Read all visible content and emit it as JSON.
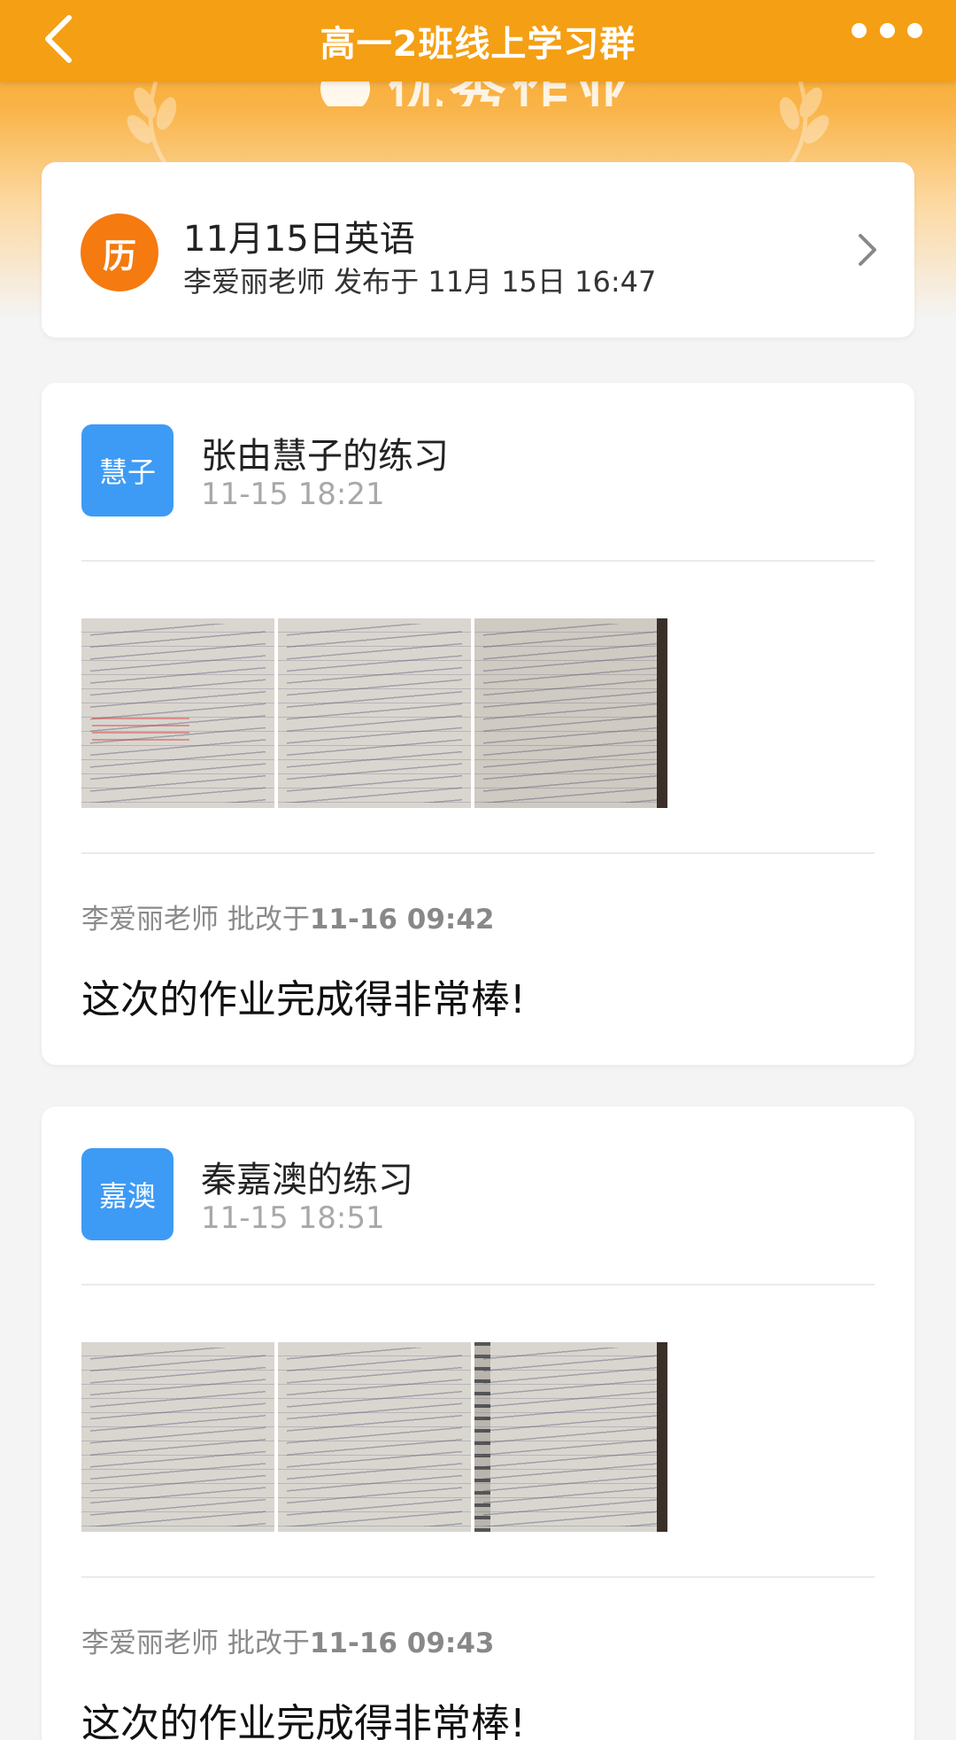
{
  "nav": {
    "title": "高一2班线上学习群",
    "back_icon": "chevron-left-icon",
    "more_icon": "more-dots-icon"
  },
  "banner": {
    "title": "优秀作业"
  },
  "assignment": {
    "badge": "历",
    "title": "11月15日英语",
    "meta": "李爱丽老师 发布于 11月 15日 16:47"
  },
  "submissions": [
    {
      "avatar": "慧子",
      "title": "张由慧子的练习",
      "time": "11-15 18:21",
      "grader_prefix": "李爱丽老师 批改于",
      "grader_time": "11-16 09:42",
      "comment": "这次的作业完成得非常棒!"
    },
    {
      "avatar": "嘉澳",
      "title": "秦嘉澳的练习",
      "time": "11-15 18:51",
      "grader_prefix": "李爱丽老师 批改于",
      "grader_time": "11-16 09:43",
      "comment": "这次的作业完成得非常棒!"
    }
  ],
  "colors": {
    "nav": "#f59f14",
    "badge": "#f57a0f",
    "avatar": "#3d9bf5"
  }
}
